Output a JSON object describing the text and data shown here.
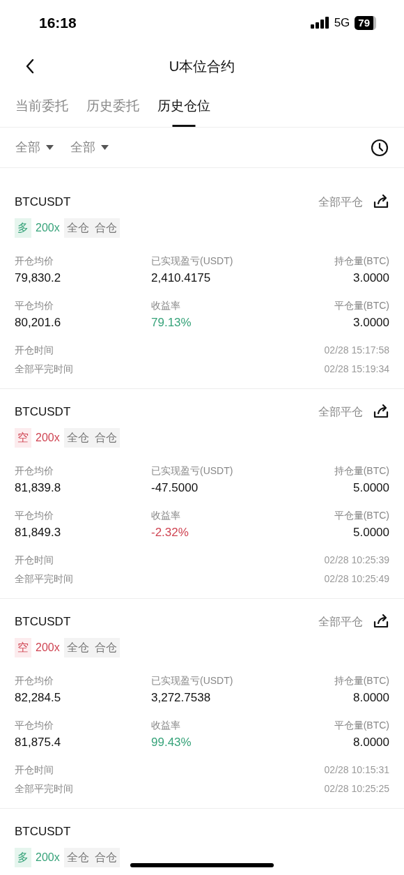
{
  "status_bar": {
    "time": "16:18",
    "network": "5G",
    "battery": "79"
  },
  "nav": {
    "title": "U本位合约"
  },
  "tabs": [
    {
      "label": "当前委托",
      "selected": false
    },
    {
      "label": "历史委托",
      "selected": false
    },
    {
      "label": "历史仓位",
      "selected": true
    }
  ],
  "filters": [
    {
      "label": "全部"
    },
    {
      "label": "全部"
    }
  ],
  "positions": [
    {
      "symbol": "BTCUSDT",
      "close_all": "全部平仓",
      "side": {
        "label": "多",
        "kind": "long"
      },
      "leverage": "200x",
      "tags": [
        "全仓",
        "合仓"
      ],
      "stats": [
        {
          "label": "开仓均价",
          "value": "79,830.2"
        },
        {
          "label": "已实现盈亏(USDT)",
          "value": "2,410.4175"
        },
        {
          "label": "持仓量(BTC)",
          "value": "3.0000"
        },
        {
          "label": "平仓均价",
          "value": "80,201.6"
        },
        {
          "label": "收益率",
          "value": "79.13%",
          "kind": "gain"
        },
        {
          "label": "平仓量(BTC)",
          "value": "3.0000"
        }
      ],
      "times": [
        {
          "label": "开仓时间",
          "value": "02/28 15:17:58"
        },
        {
          "label": "全部平完时间",
          "value": "02/28 15:19:34"
        }
      ]
    },
    {
      "symbol": "BTCUSDT",
      "close_all": "全部平仓",
      "side": {
        "label": "空",
        "kind": "short"
      },
      "leverage": "200x",
      "tags": [
        "全仓",
        "合仓"
      ],
      "stats": [
        {
          "label": "开仓均价",
          "value": "81,839.8"
        },
        {
          "label": "已实现盈亏(USDT)",
          "value": "-47.5000"
        },
        {
          "label": "持仓量(BTC)",
          "value": "5.0000"
        },
        {
          "label": "平仓均价",
          "value": "81,849.3"
        },
        {
          "label": "收益率",
          "value": "-2.32%",
          "kind": "loss"
        },
        {
          "label": "平仓量(BTC)",
          "value": "5.0000"
        }
      ],
      "times": [
        {
          "label": "开仓时间",
          "value": "02/28 10:25:39"
        },
        {
          "label": "全部平完时间",
          "value": "02/28 10:25:49"
        }
      ]
    },
    {
      "symbol": "BTCUSDT",
      "close_all": "全部平仓",
      "side": {
        "label": "空",
        "kind": "short"
      },
      "leverage": "200x",
      "tags": [
        "全仓",
        "合仓"
      ],
      "stats": [
        {
          "label": "开仓均价",
          "value": "82,284.5"
        },
        {
          "label": "已实现盈亏(USDT)",
          "value": "3,272.7538"
        },
        {
          "label": "持仓量(BTC)",
          "value": "8.0000"
        },
        {
          "label": "平仓均价",
          "value": "81,875.4"
        },
        {
          "label": "收益率",
          "value": "99.43%",
          "kind": "gain"
        },
        {
          "label": "平仓量(BTC)",
          "value": "8.0000"
        }
      ],
      "times": [
        {
          "label": "开仓时间",
          "value": "02/28 10:15:31"
        },
        {
          "label": "全部平完时间",
          "value": "02/28 10:25:25"
        }
      ]
    },
    {
      "symbol": "BTCUSDT",
      "side": {
        "label": "多",
        "kind": "long"
      },
      "leverage": "200x",
      "tags": [
        "全仓",
        "合仓"
      ]
    }
  ]
}
